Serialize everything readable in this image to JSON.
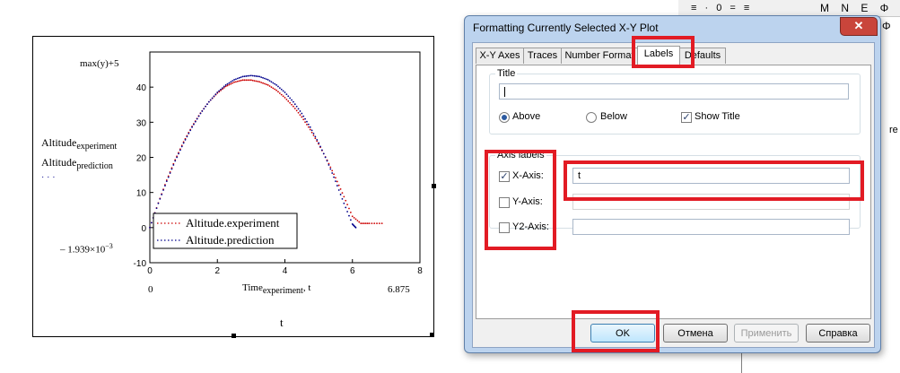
{
  "ribbon": {
    "left_symbols": "≡  ·  0  =  ≡",
    "right_symbols": "M N E Φ",
    "phi": "Φ",
    "side_text": "re"
  },
  "worksheet": {
    "ymax_label": "max(y)+5",
    "ylabel_1": {
      "main": "Altitude",
      "sub": "experiment"
    },
    "ylabel_2": {
      "main": "Altitude",
      "sub": "prediction"
    },
    "ylabel_3_marker": "· · ·",
    "ymin_label": "– 1.939×10",
    "ymin_exp": "−3",
    "xmin_label": "0",
    "xmax_label": "6.875",
    "xlabel": {
      "main": "Time",
      "sub": "experiment",
      "tail": ", t"
    },
    "bottom_label": "t"
  },
  "chart_data": {
    "type": "scatter",
    "xlim": [
      0,
      8
    ],
    "ylim": [
      -10,
      50
    ],
    "xticks": [
      0,
      2,
      4,
      6,
      8
    ],
    "yticks": [
      -10,
      0,
      10,
      20,
      30,
      40
    ],
    "grid": false,
    "legend_position": "bottom-left",
    "series": [
      {
        "name": "Altitude.experiment",
        "color": "#cc0000",
        "style": "dotted",
        "x": [
          0,
          0.25,
          0.5,
          0.75,
          1.0,
          1.25,
          1.5,
          1.75,
          2.0,
          2.25,
          2.5,
          2.75,
          3.0,
          3.25,
          3.5,
          3.75,
          4.0,
          4.25,
          4.5,
          4.75,
          5.0,
          5.25,
          5.5,
          5.75,
          6.0,
          6.25,
          6.5,
          6.875
        ],
        "y": [
          0,
          7,
          13.5,
          19.3,
          24.4,
          28.8,
          32.6,
          35.8,
          38.3,
          40.2,
          41.4,
          42.0,
          42.0,
          41.5,
          40.6,
          39.1,
          37.0,
          34.5,
          31.5,
          27.9,
          23.8,
          19.2,
          14.2,
          8.8,
          3.2,
          1.2,
          1.2,
          1.2
        ]
      },
      {
        "name": "Altitude.prediction",
        "color": "#00008b",
        "style": "dotted",
        "x": [
          0,
          0.25,
          0.5,
          0.75,
          1.0,
          1.25,
          1.5,
          1.75,
          2.0,
          2.25,
          2.5,
          2.75,
          3.0,
          3.25,
          3.5,
          3.75,
          4.0,
          4.25,
          4.5,
          4.75,
          5.0,
          5.25,
          5.5,
          5.75,
          6.0,
          6.1
        ],
        "y": [
          0,
          6.9,
          13.2,
          19.0,
          24.1,
          28.6,
          32.5,
          35.8,
          38.5,
          40.6,
          42.1,
          43.0,
          43.3,
          43.0,
          42.1,
          40.6,
          38.5,
          35.8,
          32.5,
          28.6,
          24.1,
          19.0,
          13.2,
          6.9,
          1.0,
          0.0
        ]
      }
    ]
  },
  "dialog": {
    "title": "Formatting Currently Selected X-Y Plot",
    "close": "✕",
    "tabs": [
      "X-Y Axes",
      "Traces",
      "Number Format",
      "Labels",
      "Defaults"
    ],
    "active_tab": "Labels",
    "title_group": {
      "legend": "Title",
      "value": "",
      "above": "Above",
      "below": "Below",
      "show_title": "Show Title",
      "above_selected": true,
      "show_title_checked": true
    },
    "axis_group": {
      "legend": "Axis labels",
      "x_label": "X-Axis:",
      "y_label": "Y-Axis:",
      "y2_label": "Y2-Axis:",
      "x_value": "t",
      "y_value": "",
      "y2_value": "",
      "x_checked": true,
      "y_checked": false,
      "y2_checked": false
    },
    "buttons": {
      "ok": "OK",
      "cancel": "Отмена",
      "apply": "Применить",
      "help": "Справка"
    },
    "check_mark": "✓"
  }
}
